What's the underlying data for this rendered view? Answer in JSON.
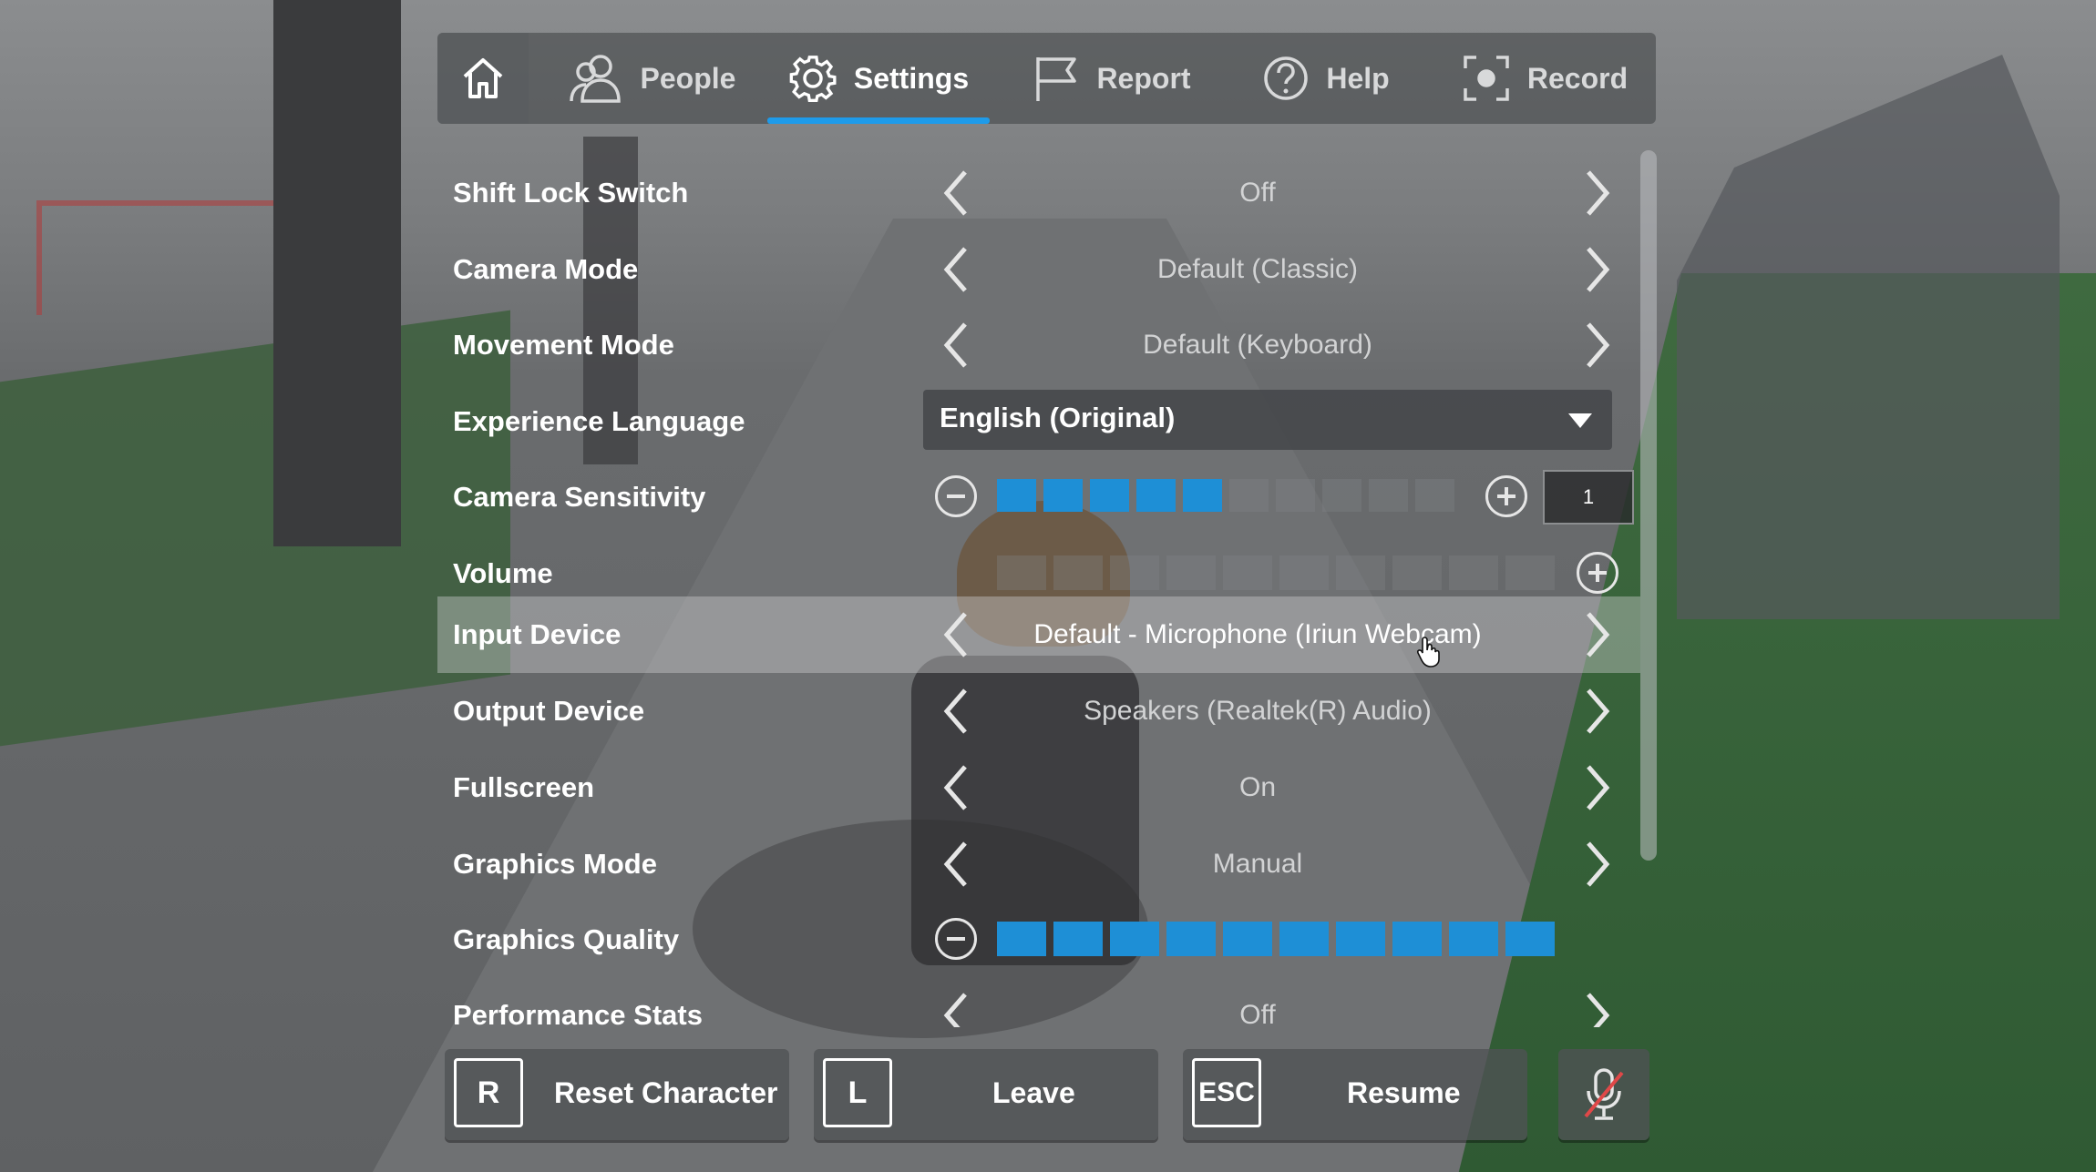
{
  "tabs": [
    {
      "label": "",
      "icon": "home-icon"
    },
    {
      "label": "People",
      "icon": "people-icon"
    },
    {
      "label": "Settings",
      "icon": "gear-icon",
      "active": true
    },
    {
      "label": "Report",
      "icon": "flag-icon"
    },
    {
      "label": "Help",
      "icon": "help-icon"
    },
    {
      "label": "Record",
      "icon": "record-icon"
    }
  ],
  "settings": {
    "shift_lock": {
      "label": "Shift Lock Switch",
      "value": "Off"
    },
    "camera_mode": {
      "label": "Camera Mode",
      "value": "Default (Classic)"
    },
    "movement_mode": {
      "label": "Movement Mode",
      "value": "Default (Keyboard)"
    },
    "language": {
      "label": "Experience Language",
      "value": "English (Original)"
    },
    "camera_sensitivity": {
      "label": "Camera Sensitivity",
      "value": "1",
      "level": 5,
      "max": 10
    },
    "volume": {
      "label": "Volume",
      "level": 0,
      "max": 10
    },
    "input_device": {
      "label": "Input Device",
      "value": "Default - Microphone (Iriun Webcam)"
    },
    "output_device": {
      "label": "Output Device",
      "value": "Speakers (Realtek(R) Audio)"
    },
    "fullscreen": {
      "label": "Fullscreen",
      "value": "On"
    },
    "graphics_mode": {
      "label": "Graphics Mode",
      "value": "Manual"
    },
    "graphics_quality": {
      "label": "Graphics Quality",
      "level": 10,
      "max": 10
    },
    "performance_stats": {
      "label": "Performance Stats",
      "value": "Off"
    }
  },
  "buttons": {
    "reset": {
      "key": "R",
      "label": "Reset Character"
    },
    "leave": {
      "key": "L",
      "label": "Leave"
    },
    "resume": {
      "key": "ESC",
      "label": "Resume"
    }
  },
  "colors": {
    "accent": "#1e9bea",
    "segment_on": "#1e8fd6",
    "mic_muted": "#e04848"
  }
}
